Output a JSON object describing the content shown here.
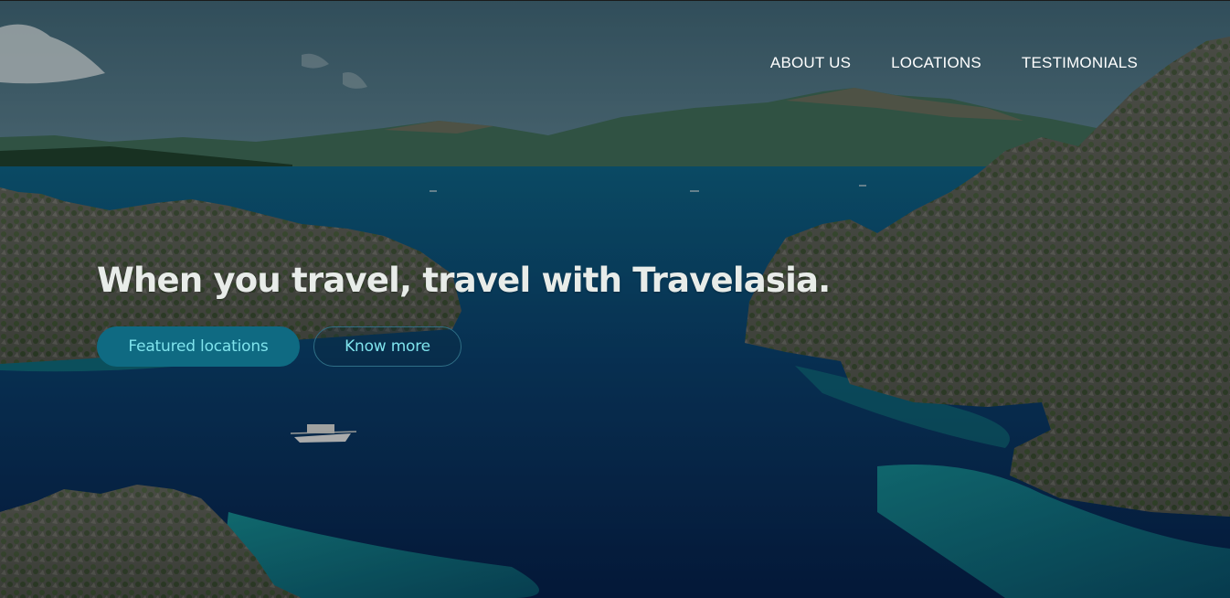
{
  "nav": {
    "items": [
      {
        "label": "ABOUT US"
      },
      {
        "label": "LOCATIONS"
      },
      {
        "label": "TESTIMONIALS"
      }
    ]
  },
  "hero": {
    "headline": "When you travel, travel with Travelasia.",
    "primary_button": "Featured locations",
    "secondary_button": "Know more",
    "image_description_icon": "tropical-lagoon-photo"
  },
  "colors": {
    "accent": "#0f6a82",
    "button_text": "#7fe3ec",
    "headline": "#e8ece9",
    "nav_text": "#ffffff"
  }
}
